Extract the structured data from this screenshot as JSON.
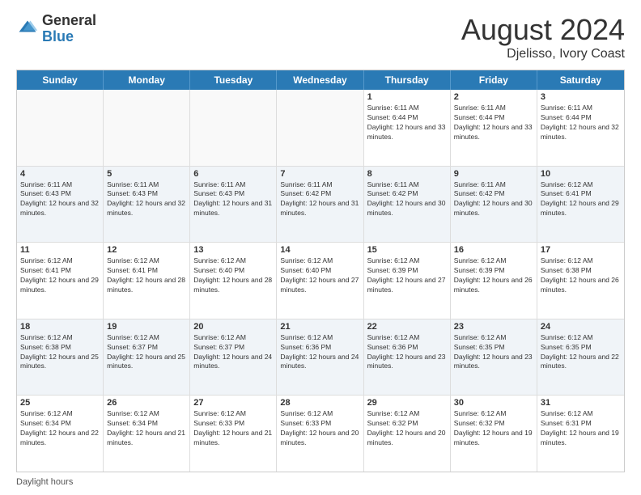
{
  "logo": {
    "general": "General",
    "blue": "Blue"
  },
  "title": "August 2024",
  "subtitle": "Djelisso, Ivory Coast",
  "days_of_week": [
    "Sunday",
    "Monday",
    "Tuesday",
    "Wednesday",
    "Thursday",
    "Friday",
    "Saturday"
  ],
  "footer_text": "Daylight hours",
  "weeks": [
    [
      {
        "day": "",
        "empty": true
      },
      {
        "day": "",
        "empty": true
      },
      {
        "day": "",
        "empty": true
      },
      {
        "day": "",
        "empty": true
      },
      {
        "day": "1",
        "sunrise": "6:11 AM",
        "sunset": "6:44 PM",
        "daylight": "12 hours and 33 minutes."
      },
      {
        "day": "2",
        "sunrise": "6:11 AM",
        "sunset": "6:44 PM",
        "daylight": "12 hours and 33 minutes."
      },
      {
        "day": "3",
        "sunrise": "6:11 AM",
        "sunset": "6:44 PM",
        "daylight": "12 hours and 32 minutes."
      }
    ],
    [
      {
        "day": "4",
        "sunrise": "6:11 AM",
        "sunset": "6:43 PM",
        "daylight": "12 hours and 32 minutes."
      },
      {
        "day": "5",
        "sunrise": "6:11 AM",
        "sunset": "6:43 PM",
        "daylight": "12 hours and 32 minutes."
      },
      {
        "day": "6",
        "sunrise": "6:11 AM",
        "sunset": "6:43 PM",
        "daylight": "12 hours and 31 minutes."
      },
      {
        "day": "7",
        "sunrise": "6:11 AM",
        "sunset": "6:42 PM",
        "daylight": "12 hours and 31 minutes."
      },
      {
        "day": "8",
        "sunrise": "6:11 AM",
        "sunset": "6:42 PM",
        "daylight": "12 hours and 30 minutes."
      },
      {
        "day": "9",
        "sunrise": "6:11 AM",
        "sunset": "6:42 PM",
        "daylight": "12 hours and 30 minutes."
      },
      {
        "day": "10",
        "sunrise": "6:12 AM",
        "sunset": "6:41 PM",
        "daylight": "12 hours and 29 minutes."
      }
    ],
    [
      {
        "day": "11",
        "sunrise": "6:12 AM",
        "sunset": "6:41 PM",
        "daylight": "12 hours and 29 minutes."
      },
      {
        "day": "12",
        "sunrise": "6:12 AM",
        "sunset": "6:41 PM",
        "daylight": "12 hours and 28 minutes."
      },
      {
        "day": "13",
        "sunrise": "6:12 AM",
        "sunset": "6:40 PM",
        "daylight": "12 hours and 28 minutes."
      },
      {
        "day": "14",
        "sunrise": "6:12 AM",
        "sunset": "6:40 PM",
        "daylight": "12 hours and 27 minutes."
      },
      {
        "day": "15",
        "sunrise": "6:12 AM",
        "sunset": "6:39 PM",
        "daylight": "12 hours and 27 minutes."
      },
      {
        "day": "16",
        "sunrise": "6:12 AM",
        "sunset": "6:39 PM",
        "daylight": "12 hours and 26 minutes."
      },
      {
        "day": "17",
        "sunrise": "6:12 AM",
        "sunset": "6:38 PM",
        "daylight": "12 hours and 26 minutes."
      }
    ],
    [
      {
        "day": "18",
        "sunrise": "6:12 AM",
        "sunset": "6:38 PM",
        "daylight": "12 hours and 25 minutes."
      },
      {
        "day": "19",
        "sunrise": "6:12 AM",
        "sunset": "6:37 PM",
        "daylight": "12 hours and 25 minutes."
      },
      {
        "day": "20",
        "sunrise": "6:12 AM",
        "sunset": "6:37 PM",
        "daylight": "12 hours and 24 minutes."
      },
      {
        "day": "21",
        "sunrise": "6:12 AM",
        "sunset": "6:36 PM",
        "daylight": "12 hours and 24 minutes."
      },
      {
        "day": "22",
        "sunrise": "6:12 AM",
        "sunset": "6:36 PM",
        "daylight": "12 hours and 23 minutes."
      },
      {
        "day": "23",
        "sunrise": "6:12 AM",
        "sunset": "6:35 PM",
        "daylight": "12 hours and 23 minutes."
      },
      {
        "day": "24",
        "sunrise": "6:12 AM",
        "sunset": "6:35 PM",
        "daylight": "12 hours and 22 minutes."
      }
    ],
    [
      {
        "day": "25",
        "sunrise": "6:12 AM",
        "sunset": "6:34 PM",
        "daylight": "12 hours and 22 minutes."
      },
      {
        "day": "26",
        "sunrise": "6:12 AM",
        "sunset": "6:34 PM",
        "daylight": "12 hours and 21 minutes."
      },
      {
        "day": "27",
        "sunrise": "6:12 AM",
        "sunset": "6:33 PM",
        "daylight": "12 hours and 21 minutes."
      },
      {
        "day": "28",
        "sunrise": "6:12 AM",
        "sunset": "6:33 PM",
        "daylight": "12 hours and 20 minutes."
      },
      {
        "day": "29",
        "sunrise": "6:12 AM",
        "sunset": "6:32 PM",
        "daylight": "12 hours and 20 minutes."
      },
      {
        "day": "30",
        "sunrise": "6:12 AM",
        "sunset": "6:32 PM",
        "daylight": "12 hours and 19 minutes."
      },
      {
        "day": "31",
        "sunrise": "6:12 AM",
        "sunset": "6:31 PM",
        "daylight": "12 hours and 19 minutes."
      }
    ]
  ]
}
